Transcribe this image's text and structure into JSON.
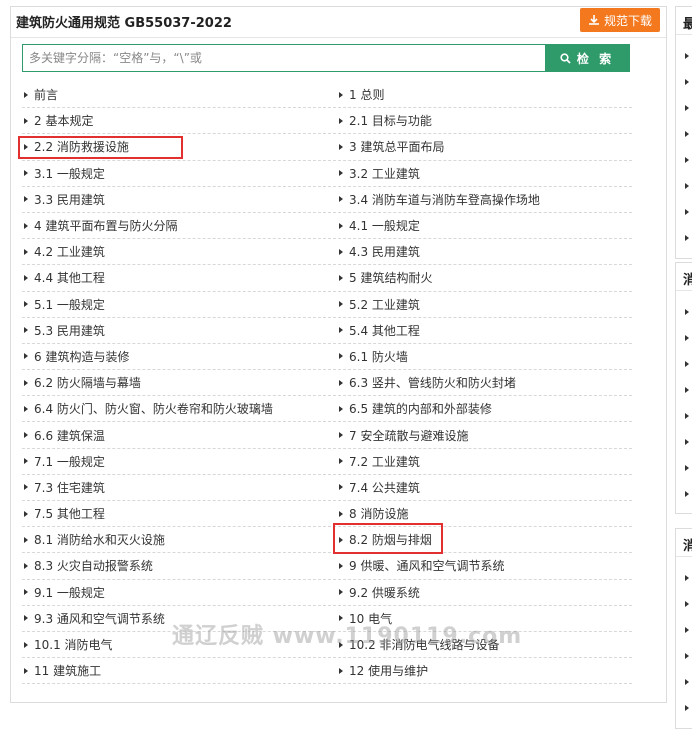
{
  "header": {
    "title": "建筑防火通用规范 GB55037-2022",
    "download_label": "规范下载"
  },
  "search": {
    "placeholder": "多关键字分隔：“空格”与，“\\”或",
    "button_label": "检 索"
  },
  "toc": {
    "rows": [
      [
        "前言",
        "1 总则"
      ],
      [
        "2 基本规定",
        "2.1 目标与功能"
      ],
      [
        "2.2 消防救援设施",
        "3 建筑总平面布局"
      ],
      [
        "3.1 一般规定",
        "3.2 工业建筑"
      ],
      [
        "3.3 民用建筑",
        "3.4 消防车道与消防车登高操作场地"
      ],
      [
        "4 建筑平面布置与防火分隔",
        "4.1 一般规定"
      ],
      [
        "4.2 工业建筑",
        "4.3 民用建筑"
      ],
      [
        "4.4 其他工程",
        "5 建筑结构耐火"
      ],
      [
        "5.1 一般规定",
        "5.2 工业建筑"
      ],
      [
        "5.3 民用建筑",
        "5.4 其他工程"
      ],
      [
        "6 建筑构造与装修",
        "6.1 防火墙"
      ],
      [
        "6.2 防火隔墙与幕墙",
        "6.3 竖井、管线防火和防火封堵"
      ],
      [
        "6.4 防火门、防火窗、防火卷帘和防火玻璃墙",
        "6.5 建筑的内部和外部装修"
      ],
      [
        "6.6 建筑保温",
        "7 安全疏散与避难设施"
      ],
      [
        "7.1 一般规定",
        "7.2 工业建筑"
      ],
      [
        "7.3 住宅建筑",
        "7.4 公共建筑"
      ],
      [
        "7.5 其他工程",
        "8 消防设施"
      ],
      [
        "8.1 消防给水和灭火设施",
        "8.2 防烟与排烟"
      ],
      [
        "8.3 火灾自动报警系统",
        "9 供暖、通风和空气调节系统"
      ],
      [
        "9.1 一般规定",
        "9.2 供暖系统"
      ],
      [
        "9.3 通风和空气调节系统",
        "10 电气"
      ],
      [
        "10.1 消防电气",
        "10.2 非消防电气线路与设备"
      ],
      [
        "11 建筑施工",
        "12 使用与维护"
      ]
    ]
  },
  "watermark": "通辽反贼 www.1190119.com",
  "sidebar": {
    "headers": [
      "最",
      "消",
      "消"
    ]
  },
  "colors": {
    "accent_orange": "#f3781e",
    "accent_green": "#2f9a6a",
    "highlight_red": "#e23030"
  }
}
